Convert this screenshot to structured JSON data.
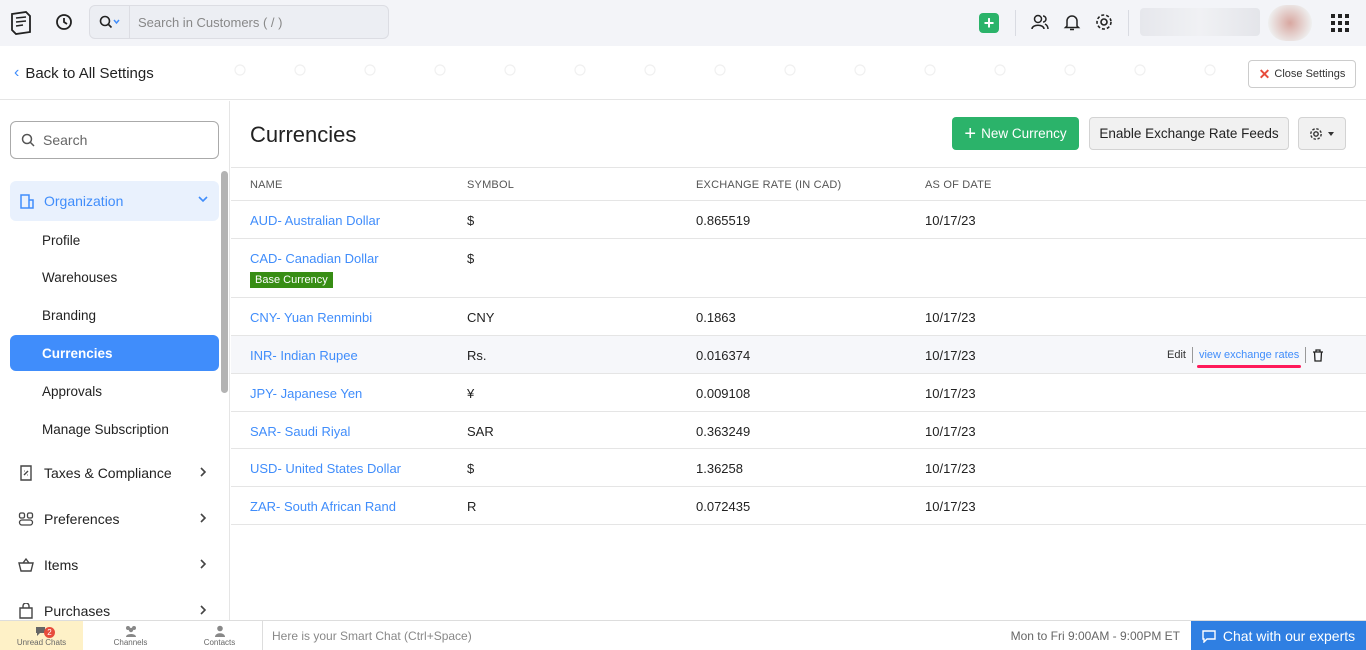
{
  "topbar": {
    "search_placeholder": "Search in Customers ( / )"
  },
  "settings_header": {
    "back_label": "Back to All Settings",
    "close_label": "Close Settings"
  },
  "sidebar": {
    "search_placeholder": "Search",
    "org_label": "Organization",
    "org_items": [
      {
        "label": "Profile"
      },
      {
        "label": "Warehouses"
      },
      {
        "label": "Branding"
      },
      {
        "label": "Currencies",
        "active": true
      },
      {
        "label": "Approvals"
      },
      {
        "label": "Manage Subscription"
      }
    ],
    "groups": [
      {
        "label": "Taxes & Compliance",
        "icon": "receipt-icon"
      },
      {
        "label": "Preferences",
        "icon": "sliders-icon"
      },
      {
        "label": "Items",
        "icon": "basket-icon"
      },
      {
        "label": "Purchases",
        "icon": "bag-icon"
      }
    ]
  },
  "main": {
    "title": "Currencies",
    "new_button": "New Currency",
    "feeds_button": "Enable Exchange Rate Feeds",
    "columns": [
      "NAME",
      "SYMBOL",
      "EXCHANGE RATE (IN CAD)",
      "AS OF DATE"
    ],
    "base_badge": "Base Currency",
    "rows": [
      {
        "name": "AUD- Australian Dollar",
        "symbol": "$",
        "rate": "0.865519",
        "date": "10/17/23"
      },
      {
        "name": "CAD- Canadian Dollar",
        "symbol": "$",
        "rate": "",
        "date": ""
      },
      {
        "name": "CNY- Yuan Renminbi",
        "symbol": "CNY",
        "rate": "0.1863",
        "date": "10/17/23"
      },
      {
        "name": "INR- Indian Rupee",
        "symbol": "Rs.",
        "rate": "0.016374",
        "date": "10/17/23"
      },
      {
        "name": "JPY- Japanese Yen",
        "symbol": "¥",
        "rate": "0.009108",
        "date": "10/17/23"
      },
      {
        "name": "SAR- Saudi Riyal",
        "symbol": "SAR",
        "rate": "0.363249",
        "date": "10/17/23"
      },
      {
        "name": "USD- United States Dollar",
        "symbol": "$",
        "rate": "1.36258",
        "date": "10/17/23"
      },
      {
        "name": "ZAR- South African Rand",
        "symbol": "R",
        "rate": "0.072435",
        "date": "10/17/23"
      }
    ],
    "row_actions": {
      "edit": "Edit",
      "view": "view exchange rates"
    }
  },
  "bottombar": {
    "unread_label": "Unread Chats",
    "unread_count": "2",
    "channels_label": "Channels",
    "contacts_label": "Contacts",
    "smartchat_placeholder": "Here is your Smart Chat (Ctrl+Space)",
    "hours": "Mon to Fri 9:00AM - 9:00PM ET",
    "chat_button": "Chat with our experts"
  },
  "colors": {
    "accent": "#408dfb",
    "primary_green": "#2bb36a",
    "badge_green": "#378d14",
    "highlight": "#ff1a5a"
  }
}
